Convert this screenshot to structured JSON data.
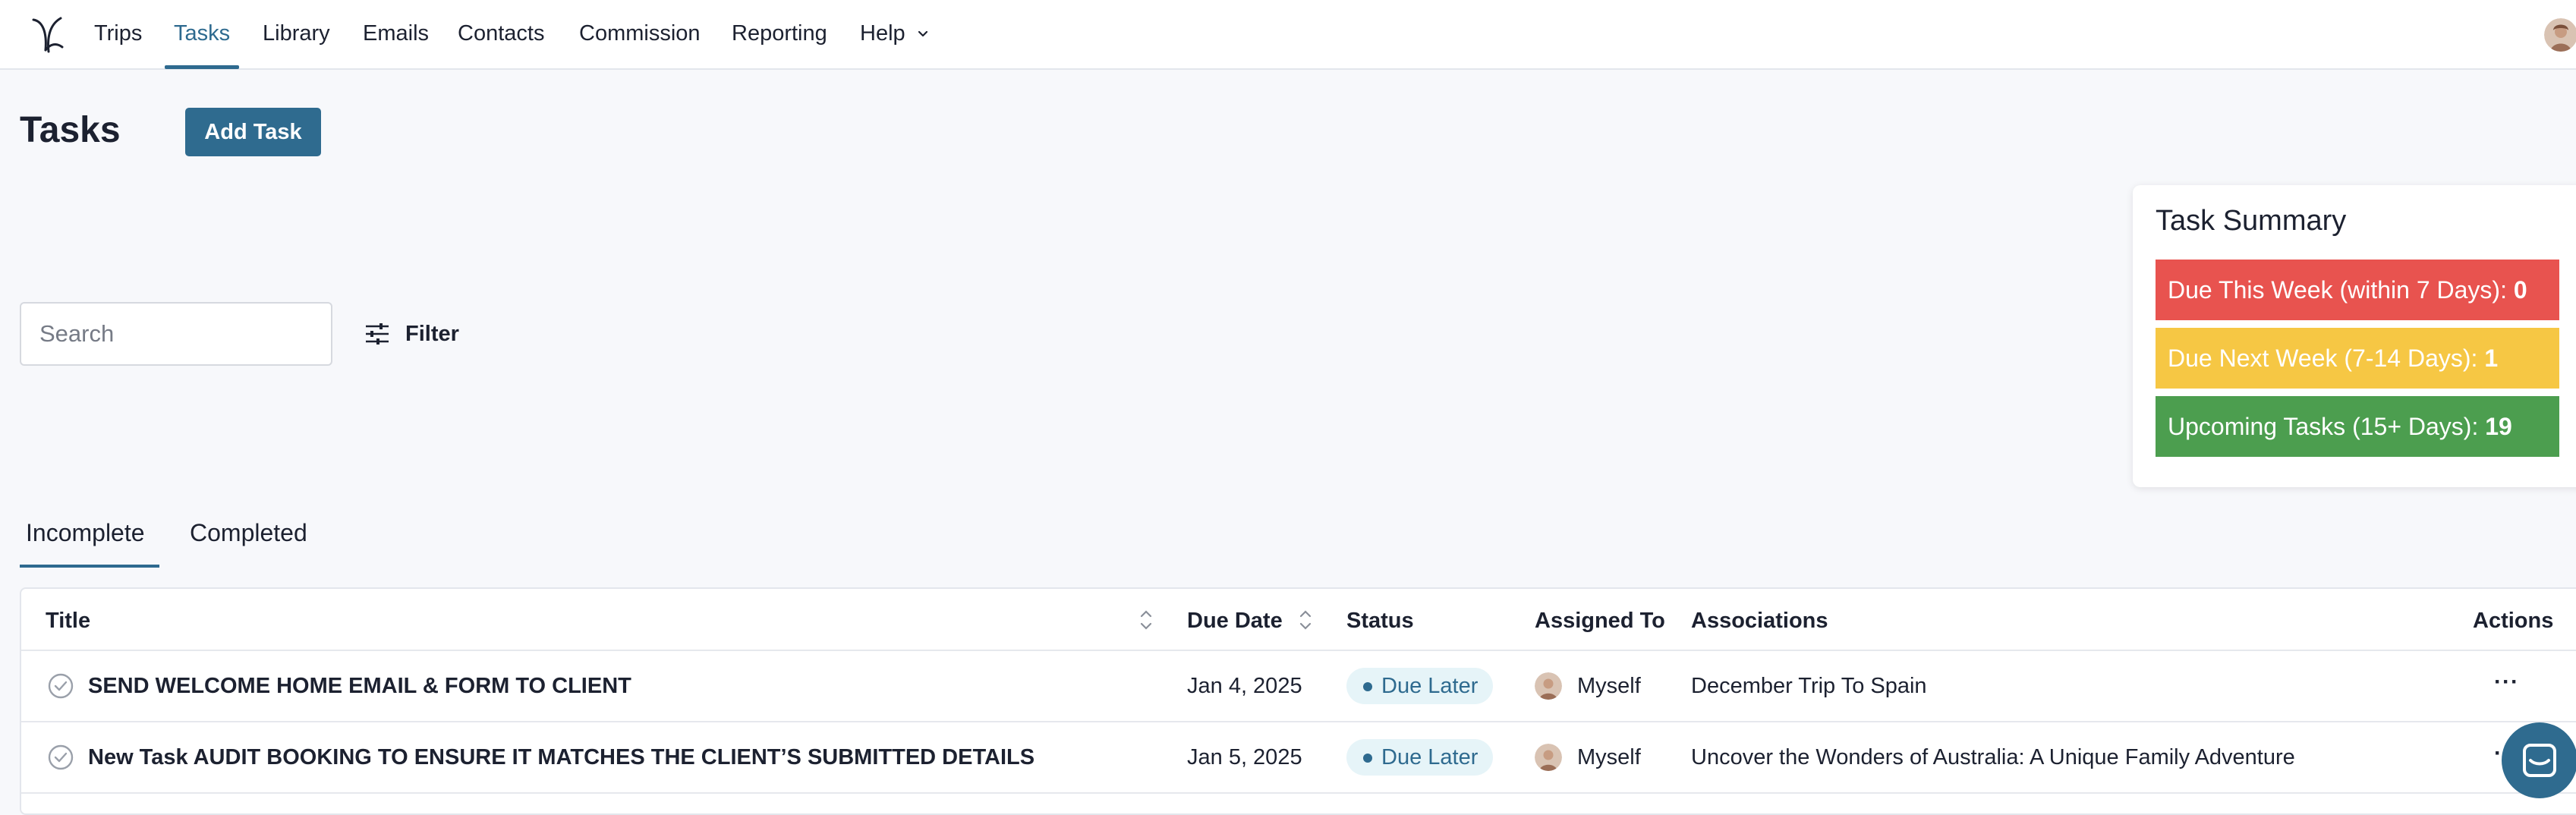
{
  "nav": {
    "items": [
      {
        "label": "Trips"
      },
      {
        "label": "Tasks"
      },
      {
        "label": "Library"
      },
      {
        "label": "Emails"
      },
      {
        "label": "Contacts"
      },
      {
        "label": "Commission"
      },
      {
        "label": "Reporting"
      },
      {
        "label": "Help"
      }
    ],
    "active": "Tasks"
  },
  "header": {
    "title": "Tasks",
    "add_button": "Add Task"
  },
  "search": {
    "placeholder": "Search",
    "value": ""
  },
  "filter": {
    "label": "Filter"
  },
  "summary": {
    "title": "Task Summary",
    "rows": [
      {
        "label": "Due This Week (within 7 Days):",
        "count": "0",
        "color": "#e8534f"
      },
      {
        "label": "Due Next Week (7-14 Days):",
        "count": "1",
        "color": "#f6c744"
      },
      {
        "label": "Upcoming Tasks (15+ Days):",
        "count": "19",
        "color": "#4c9e4f"
      }
    ]
  },
  "tabs": [
    {
      "label": "Incomplete",
      "active": true
    },
    {
      "label": "Completed",
      "active": false
    }
  ],
  "table": {
    "columns": [
      "Title",
      "Due Date",
      "Status",
      "Assigned To",
      "Associations",
      "Actions"
    ],
    "rows": [
      {
        "title": "SEND WELCOME HOME EMAIL & FORM TO CLIENT",
        "due_date": "Jan 4, 2025",
        "status": "Due Later",
        "assigned_to": "Myself",
        "association": "December Trip To Spain",
        "actions": "···"
      },
      {
        "title": "New Task AUDIT BOOKING TO ENSURE IT MATCHES THE CLIENT’S SUBMITTED DETAILS",
        "due_date": "Jan 5, 2025",
        "status": "Due Later",
        "assigned_to": "Myself",
        "association": "Uncover the Wonders of Australia: A Unique Family Adventure",
        "actions": "···"
      }
    ]
  },
  "colors": {
    "accent": "#2e6a8f",
    "primary_button": "#2f6b8f",
    "status_pill_bg": "#e6f4f8"
  }
}
